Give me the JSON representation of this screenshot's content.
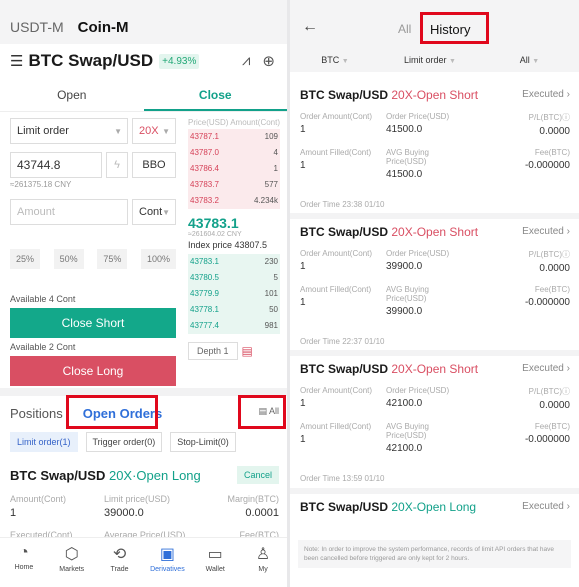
{
  "left": {
    "top_tabs": [
      "USDT-M",
      "Coin-M"
    ],
    "pair": "BTC Swap/USD",
    "change": "+4.93%",
    "oc_tabs": [
      "Open",
      "Close"
    ],
    "order_type": "Limit order",
    "leverage": "20X",
    "price": "43744.8",
    "bbo": "BBO",
    "cny": "≈261375.18 CNY",
    "amount_placeholder": "Amount",
    "amount_unit": "Cont",
    "pcts": [
      "25%",
      "50%",
      "75%",
      "100%"
    ],
    "available_short": "Available 4 Cont",
    "close_short": "Close Short",
    "available_long": "Available 2 Cont",
    "close_long": "Close Long",
    "book": {
      "hdr_price": "Price(USD)",
      "hdr_amount": "Amount(Cont)",
      "asks": [
        [
          "43787.1",
          "109"
        ],
        [
          "43787.0",
          "4"
        ],
        [
          "43786.4",
          "1"
        ],
        [
          "43783.7",
          "577"
        ],
        [
          "43783.2",
          "4.234k"
        ]
      ],
      "mid": "43783.1",
      "mid_cny": "≈261604.02 CNY",
      "index": "Index price 43807.5",
      "bids": [
        [
          "43783.1",
          "230"
        ],
        [
          "43780.5",
          "5"
        ],
        [
          "43779.9",
          "101"
        ],
        [
          "43778.1",
          "50"
        ],
        [
          "43777.4",
          "981"
        ]
      ],
      "depth": "Depth 1"
    },
    "pos_tabs": [
      "Positions",
      "Open Orders"
    ],
    "all": "All",
    "chips": [
      "Limit order(1)",
      "Trigger order(0)",
      "Stop-Limit(0)"
    ],
    "order": {
      "pair": "BTC Swap/USD",
      "side": "20X·Open Long",
      "cancel": "Cancel",
      "amount_label": "Amount(Cont)",
      "amount": "1",
      "limit_label": "Limit price(USD)",
      "limit": "39000.0",
      "margin_label": "Margin(BTC)",
      "margin": "0.0001",
      "exec_label": "Executed(Cont)",
      "avg_label": "Average Price(USD)",
      "fee_label": "Fee(BTC)"
    },
    "nav": [
      "Home",
      "Markets",
      "Trade",
      "Derivatives",
      "Wallet",
      "My"
    ]
  },
  "right": {
    "seg_all": "All",
    "seg_history": "History",
    "filters": [
      "BTC",
      "Limit order",
      "All"
    ],
    "labels": {
      "order_amount": "Order Amount(Cont)",
      "order_price": "Order Price(USD)",
      "pl": "P/L(BTC)",
      "filled": "Amount Filled(Cont)",
      "avg_buy": "AVG Buying Price(USD)",
      "fee": "Fee(BTC)"
    },
    "orders": [
      {
        "pair": "BTC Swap/USD",
        "side": "20X-Open Short",
        "status": "Executed",
        "amount": "1",
        "price": "41500.0",
        "pl": "0.0000",
        "filled": "1",
        "avg": "41500.0",
        "fee": "-0.000000",
        "time": "Order Time 23:38 01/10"
      },
      {
        "pair": "BTC Swap/USD",
        "side": "20X-Open Short",
        "status": "Executed",
        "amount": "1",
        "price": "39900.0",
        "pl": "0.0000",
        "filled": "1",
        "avg": "39900.0",
        "fee": "-0.000000",
        "time": "Order Time 22:37 01/10"
      },
      {
        "pair": "BTC Swap/USD",
        "side": "20X-Open Short",
        "status": "Executed",
        "amount": "1",
        "price": "42100.0",
        "pl": "0.0000",
        "filled": "1",
        "avg": "42100.0",
        "fee": "-0.000000",
        "time": "Order Time 13:59 01/10"
      },
      {
        "pair": "BTC Swap/USD",
        "side": "20X-Open Long",
        "status": "Executed"
      }
    ],
    "note": "Note: In order to improve the system performance, records of limit API orders that have been cancelled before triggered are only kept for 2 hours."
  },
  "colors": {
    "green": "#13a18a",
    "red": "#d94f63",
    "highlight": "#e0081c"
  }
}
